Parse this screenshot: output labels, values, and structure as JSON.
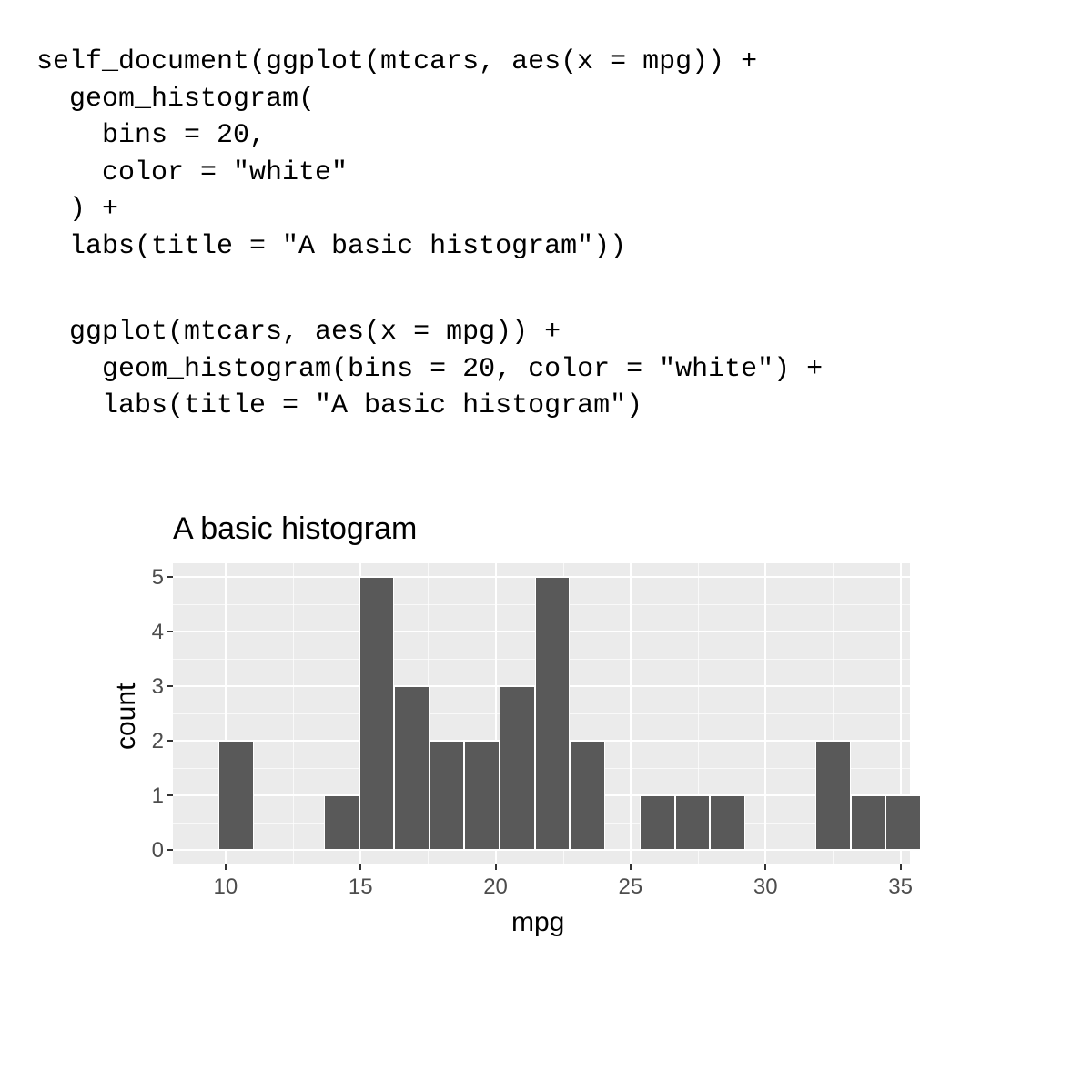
{
  "code": {
    "block1": "self_document(ggplot(mtcars, aes(x = mpg)) +\n  geom_histogram(\n    bins = 20,\n    color = \"white\"\n  ) +\n  labs(title = \"A basic histogram\"))",
    "block2": "  ggplot(mtcars, aes(x = mpg)) +\n    geom_histogram(bins = 20, color = \"white\") +\n    labs(title = \"A basic histogram\")"
  },
  "chart_data": {
    "type": "bar",
    "title": "A basic histogram",
    "xlabel": "mpg",
    "ylabel": "count",
    "xlim": [
      8.05,
      35.35
    ],
    "ylim": [
      -0.25,
      5.25
    ],
    "x_ticks": [
      10,
      15,
      20,
      25,
      30,
      35
    ],
    "y_ticks": [
      0,
      1,
      2,
      3,
      4,
      5
    ],
    "bar_fill": "#595959",
    "bar_stroke": "#ffffff",
    "bars": [
      {
        "center": 10.4,
        "count": 2
      },
      {
        "center": 11.7,
        "count": 0
      },
      {
        "center": 13.0,
        "count": 0
      },
      {
        "center": 14.3,
        "count": 1
      },
      {
        "center": 15.6,
        "count": 5
      },
      {
        "center": 16.9,
        "count": 3
      },
      {
        "center": 18.2,
        "count": 2
      },
      {
        "center": 19.5,
        "count": 2
      },
      {
        "center": 20.8,
        "count": 3
      },
      {
        "center": 22.1,
        "count": 5
      },
      {
        "center": 23.4,
        "count": 2
      },
      {
        "center": 24.7,
        "count": 0
      },
      {
        "center": 26.0,
        "count": 1
      },
      {
        "center": 27.3,
        "count": 1
      },
      {
        "center": 28.6,
        "count": 1
      },
      {
        "center": 29.9,
        "count": 0
      },
      {
        "center": 31.2,
        "count": 0
      },
      {
        "center": 32.5,
        "count": 2
      },
      {
        "center": 33.8,
        "count": 1
      },
      {
        "center": 35.1,
        "count": 1
      }
    ],
    "bin_width": 1.3
  }
}
